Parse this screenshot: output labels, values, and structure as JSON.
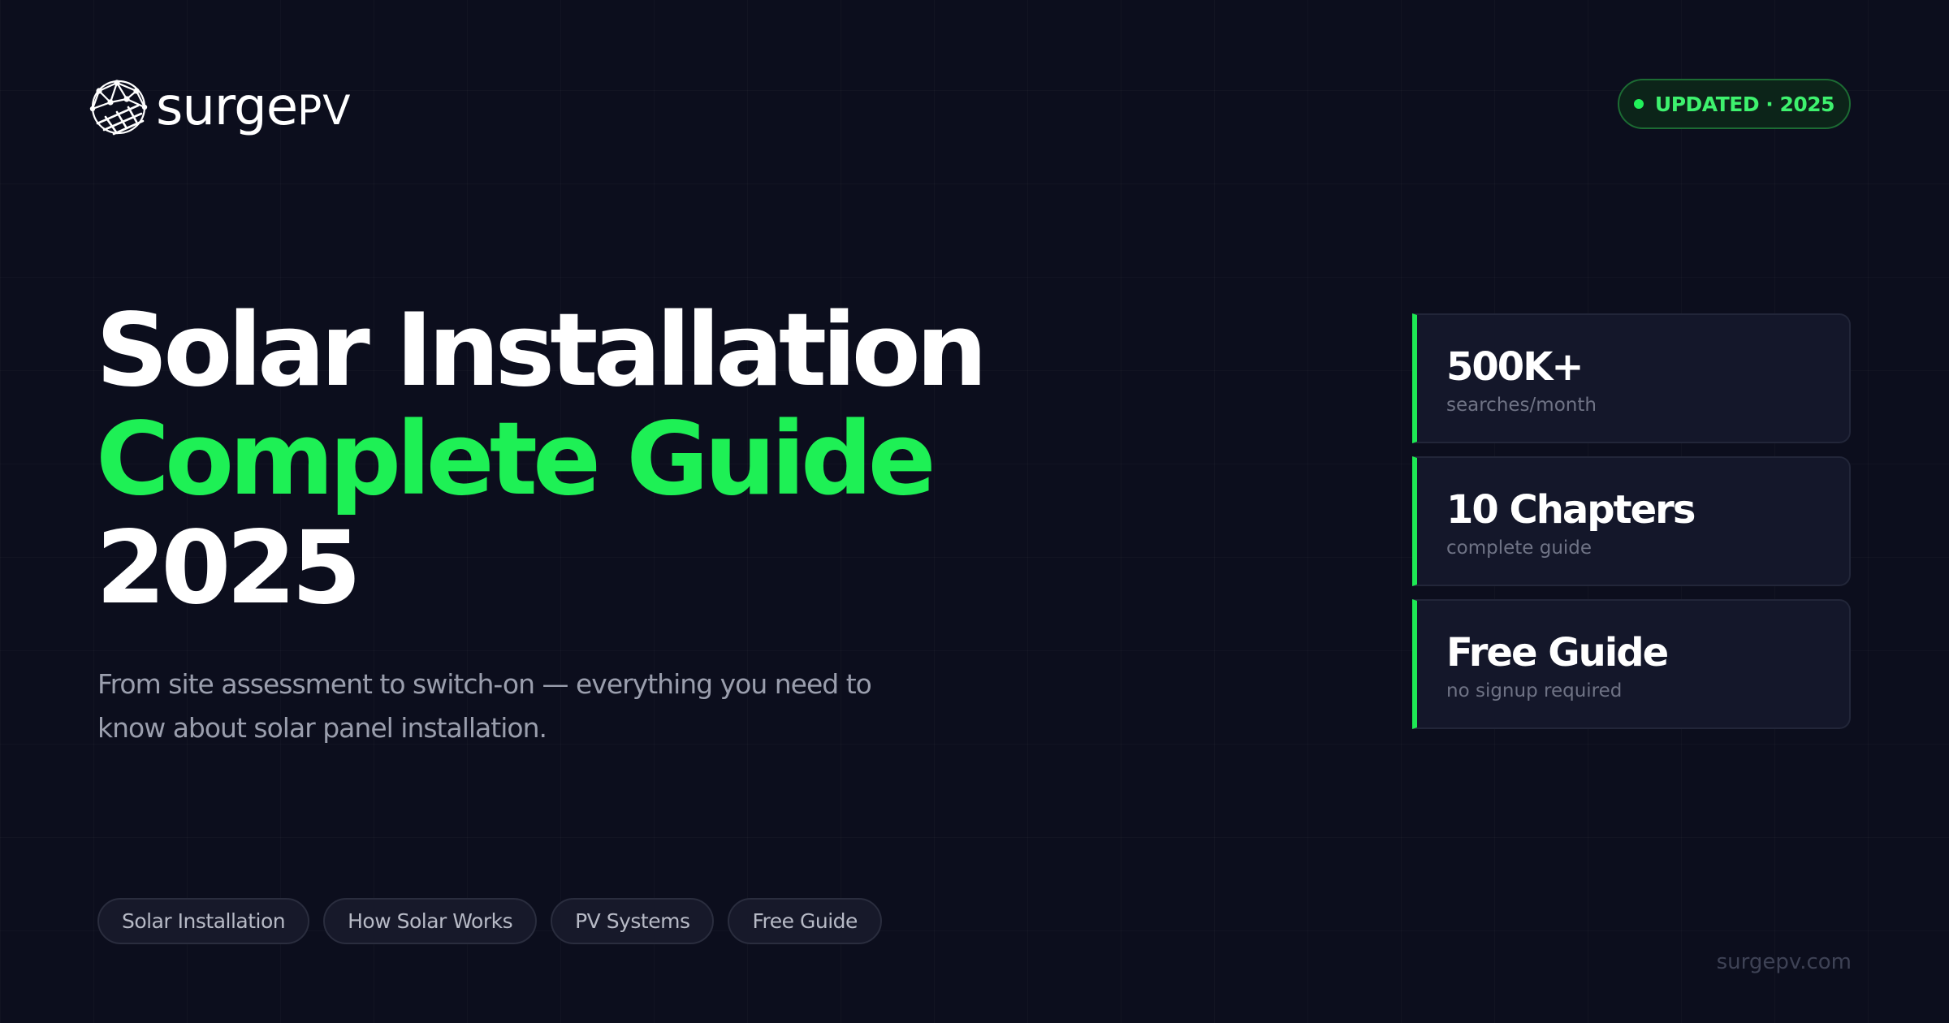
{
  "brand": {
    "name_main": "surge",
    "name_suffix": "PV",
    "logo_icon": "solar-globe-icon"
  },
  "badge": {
    "text": "UPDATED · 2025",
    "dot_color": "#21f25a"
  },
  "headline": {
    "line1": "Solar Installation",
    "line2": "Complete Guide",
    "line3": "2025"
  },
  "subtitle": {
    "line1": "From site assessment to switch-on — everything you need to",
    "line2": "know about solar panel installation."
  },
  "stats": [
    {
      "value": "500K+",
      "label": "searches/month"
    },
    {
      "value": "10 Chapters",
      "label": "complete guide"
    },
    {
      "value": "Free Guide",
      "label": "no signup required"
    }
  ],
  "tags": [
    {
      "label": "Solar Installation"
    },
    {
      "label": "How Solar Works"
    },
    {
      "label": "PV Systems"
    },
    {
      "label": "Free Guide"
    }
  ],
  "footer": {
    "url": "surgepv.com"
  },
  "colors": {
    "background": "#0c0e1d",
    "accent_green": "#1ef055",
    "text_white": "#ffffff",
    "text_muted": "#9a9ead"
  }
}
